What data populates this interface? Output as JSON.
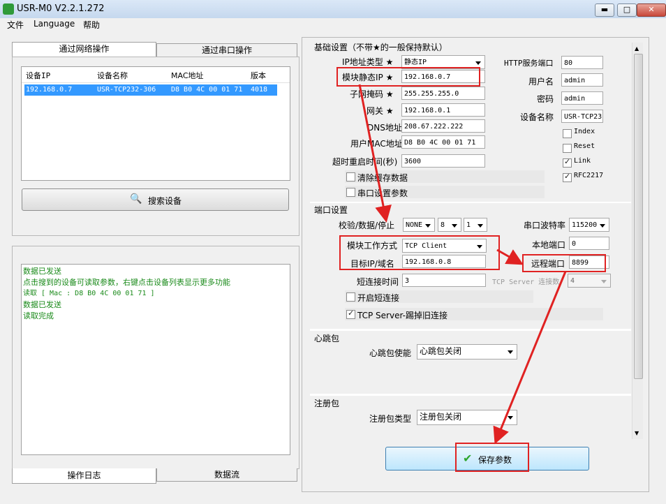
{
  "window": {
    "title": "USR-M0 V2.2.1.272",
    "min": "▬",
    "max": "□",
    "close": "✕"
  },
  "menu": [
    "文件",
    "Language",
    "帮助"
  ],
  "left": {
    "tabs": [
      "通过网络操作",
      "通过串口操作"
    ],
    "table": {
      "headers": [
        "设备IP",
        "设备名称",
        "MAC地址",
        "版本"
      ],
      "rows": [
        [
          "192.168.0.7",
          "USR-TCP232-306",
          "D8 B0 4C 00 01 71",
          "4018"
        ]
      ]
    },
    "search_button": "搜索设备",
    "log_lines": [
      "数据已发送",
      "点击搜到的设备可读取参数，右键点击设备列表显示更多功能",
      "读取 [ Mac : D8 B0 4C 00 01 71 ]",
      "数据已发送",
      "读取完成"
    ],
    "bottom_tabs": [
      "操作日志",
      "数据流"
    ]
  },
  "basic": {
    "title": "基础设置（不带★的一般保持默认）",
    "ip_type_label": "IP地址类型",
    "ip_type_value": "静态IP",
    "static_ip_label": "模块静态IP",
    "static_ip_value": "192.168.0.7",
    "mask_label": "子网掩码",
    "mask_value": "255.255.255.0",
    "gateway_label": "网关",
    "gateway_value": "192.168.0.1",
    "dns_label": "DNS地址",
    "dns_value": "208.67.222.222",
    "mac_label": "用户MAC地址",
    "mac_value": "D8 B0 4C 00 01 71",
    "timeout_label": "超时重启时间(秒)",
    "timeout_value": "3600",
    "clear_cache_label": "清除缓存数据",
    "serial_param_label": "串口设置参数",
    "star": "★",
    "http_port_label": "HTTP服务端口",
    "http_port_value": "80",
    "user_label": "用户名",
    "user_value": "admin",
    "pwd_label": "密码",
    "pwd_value": "admin",
    "devname_label": "设备名称",
    "devname_value": "USR-TCP23",
    "checks": [
      {
        "label": "Index",
        "checked": false
      },
      {
        "label": "Reset",
        "checked": false
      },
      {
        "label": "Link",
        "checked": true
      },
      {
        "label": "RFC2217",
        "checked": true
      }
    ]
  },
  "port": {
    "title": "端口设置",
    "parity_label": "校验/数据/停止",
    "parity": "NONE",
    "databits": "8",
    "stopbits": "1",
    "baud_label": "串口波特率",
    "baud": "115200",
    "mode_label": "模块工作方式",
    "mode": "TCP Client",
    "local_port_label": "本地端口",
    "local_port": "0",
    "target_label": "目标IP/域名",
    "target": "192.168.0.8",
    "remote_port_label": "远程端口",
    "remote_port": "8899",
    "short_conn_label": "短连接时间",
    "short_conn": "3",
    "tcp_server_conn_label": "TCP Server 连接数",
    "tcp_server_conn": "4",
    "enable_short_label": "开启短连接",
    "kick_label": "TCP Server-踢掉旧连接"
  },
  "heartbeat": {
    "title": "心跳包",
    "enable_label": "心跳包使能",
    "value": "心跳包关闭"
  },
  "register": {
    "title": "注册包",
    "type_label": "注册包类型",
    "value": "注册包关闭"
  },
  "save_button": "保存参数",
  "colors": {
    "accent_red": "#e02222",
    "log_green": "#1a8a1a",
    "selection": "#3399ff"
  }
}
